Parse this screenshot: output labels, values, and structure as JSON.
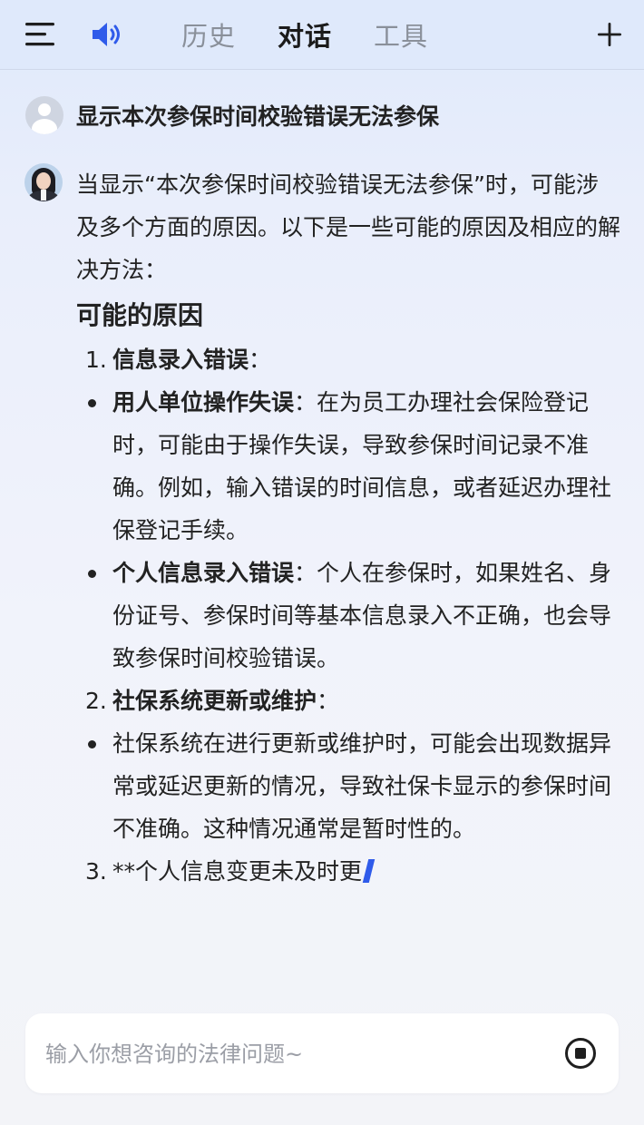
{
  "header": {
    "tabs": [
      {
        "label": "历史",
        "active": false
      },
      {
        "label": "对话",
        "active": true
      },
      {
        "label": "工具",
        "active": false
      }
    ],
    "icons": {
      "menu": "menu-icon",
      "speaker": "speaker-icon",
      "new_chat": "plus-icon"
    },
    "accent_color": "#2f5bea"
  },
  "conversation": {
    "user_message": "显示本次参保时间校验错误无法参保",
    "answer": {
      "intro": "当显示“本次参保时间校验错误无法参保”时，可能涉及多个方面的原因。以下是一些可能的原因及相应的解决方法：",
      "section_heading": "可能的原因",
      "items": [
        {
          "number": "1.",
          "title": "信息录入错误",
          "suffix": "：",
          "bullets": [
            {
              "bold": "用人单位操作失误",
              "text": "：在为员工办理社会保险登记时，可能由于操作失误，导致参保时间记录不准确。例如，输入错误的时间信息，或者延迟办理社保登记手续。"
            },
            {
              "bold": "个人信息录入错误",
              "text": "：个人在参保时，如果姓名、身份证号、参保时间等基本信息录入不正确，也会导致参保时间校验错误。"
            }
          ]
        },
        {
          "number": "2.",
          "title": "社保系统更新或维护",
          "suffix": "：",
          "bullets": [
            {
              "bold": "",
              "text": "社保系统在进行更新或维护时，可能会出现数据异常或延迟更新的情况，导致社保卡显示的参保时间不准确。这种情况通常是暂时性的。"
            }
          ]
        },
        {
          "number": "3.",
          "partial_text": "**个人信息变更未及时更"
        }
      ]
    }
  },
  "input": {
    "placeholder": "输入你想咨询的法律问题~",
    "value": ""
  }
}
